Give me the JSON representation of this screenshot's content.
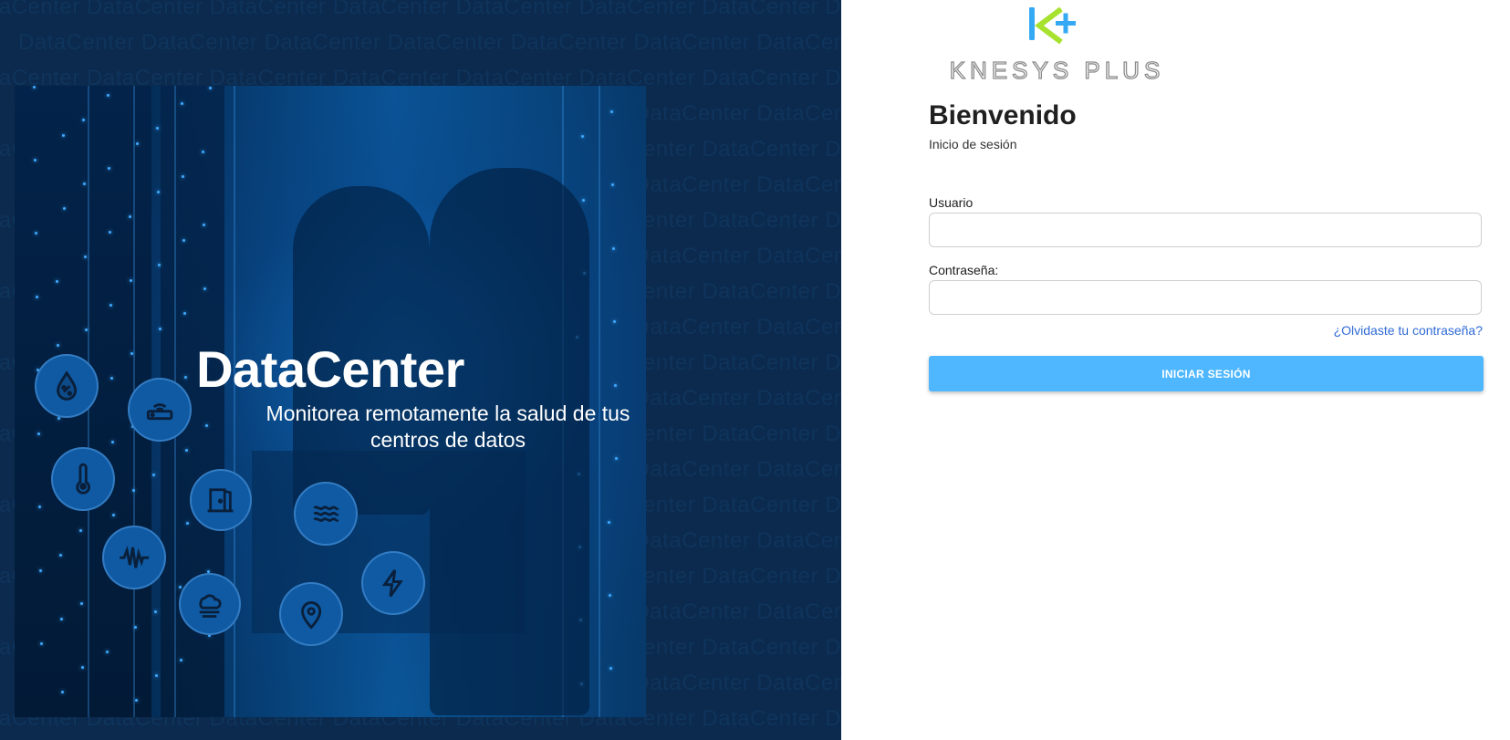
{
  "left_panel": {
    "watermark_text": "DataCenter",
    "hero_title": "DataCenter",
    "hero_subtitle": "Monitorea remotamente la salud de tus centros de datos",
    "icons": [
      "humidity-icon",
      "router-icon",
      "thermometer-icon",
      "door-icon",
      "water-leak-icon",
      "vibration-icon",
      "smoke-icon",
      "location-icon",
      "power-icon"
    ]
  },
  "logo": {
    "mark_text": "K+",
    "wordmark": "KNESYS PLUS",
    "colors": {
      "k_bar": "#36a9f4",
      "chevron": "#a6e22e",
      "plus": "#36a9f4",
      "wordmark": "#8c8c8c"
    }
  },
  "login": {
    "title": "Bienvenido",
    "subtitle": "Inicio de sesión",
    "username_label": "Usuario",
    "username_value": "",
    "password_label": "Contraseña:",
    "password_value": "",
    "forgot_link": "¿Olvidaste tu contraseña?",
    "submit_label": "INICIAR SESIÓN"
  },
  "colors": {
    "left_bg": "#0b2a4d",
    "button": "#4fb7ff",
    "link": "#2f6bd6"
  }
}
